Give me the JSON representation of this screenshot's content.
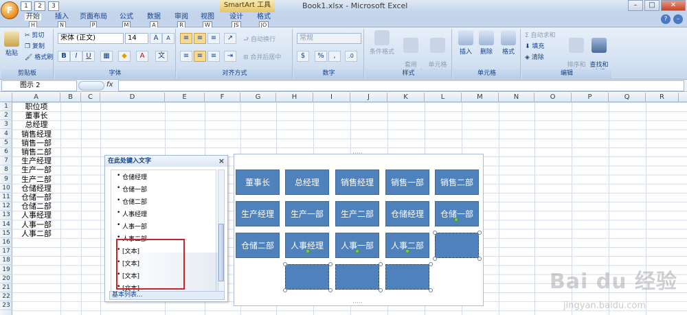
{
  "title": {
    "contextual_tab": "SmartArt 工具",
    "window_title": "Book1.xlsx - Microsoft Excel",
    "qat_keys": [
      "1",
      "2",
      "3"
    ],
    "controls": {
      "minimize": "–",
      "restore": "□",
      "close": "✕"
    }
  },
  "tabs": [
    {
      "label": "开始",
      "key": "H",
      "active": true
    },
    {
      "label": "插入",
      "key": "N"
    },
    {
      "label": "页面布局",
      "key": "P"
    },
    {
      "label": "公式",
      "key": "M"
    },
    {
      "label": "数据",
      "key": "A"
    },
    {
      "label": "审阅",
      "key": "R"
    },
    {
      "label": "视图",
      "key": "W"
    },
    {
      "label": "设计",
      "key": "JS"
    },
    {
      "label": "格式",
      "key": "JO"
    }
  ],
  "ribbon": {
    "clipboard": {
      "name": "剪贴板",
      "paste": "粘贴",
      "cut": "剪切",
      "copy": "复制",
      "format_painter": "格式刷"
    },
    "font": {
      "name": "字体",
      "font_name": "宋体 (正文)",
      "font_size": "14",
      "bold": "B",
      "italic": "I",
      "underline": "U"
    },
    "alignment": {
      "name": "对齐方式",
      "wrap": "自动换行",
      "merge": "合并后居中"
    },
    "number": {
      "name": "数字",
      "format": "常规",
      "percent": "%",
      "comma": ","
    },
    "styles": {
      "name": "样式",
      "conditional": "条件格式",
      "table": "套用\n表格格式",
      "cell": "单元格\n样式"
    },
    "cells": {
      "name": "单元格",
      "insert": "插入",
      "delete": "删除",
      "format": "格式"
    },
    "editing": {
      "name": "编辑",
      "autosum": "Σ 自动求和",
      "fill": "填充",
      "clear": "清除",
      "sort": "排序和\n筛选",
      "find": "查找和\n选择"
    }
  },
  "formula_bar": {
    "namebox": "图示 2",
    "fx": "fx",
    "value": ""
  },
  "columns": [
    "A",
    "B",
    "C",
    "D",
    "E",
    "F",
    "G",
    "H",
    "I",
    "J",
    "K",
    "L",
    "M",
    "N",
    "O",
    "P",
    "Q",
    "R"
  ],
  "rows": [
    "1",
    "2",
    "3",
    "4",
    "5",
    "6",
    "7",
    "8",
    "9",
    "10",
    "11",
    "12",
    "13",
    "14",
    "15",
    "16",
    "17",
    "18",
    "19",
    "20",
    "21",
    "22",
    "23"
  ],
  "column_a": [
    "职位项",
    "董事长",
    "总经理",
    "销售经理",
    "销售一部",
    "销售二部",
    "生产经理",
    "生产一部",
    "生产二部",
    "仓储经理",
    "仓储一部",
    "仓储二部",
    "人事经理",
    "人事一部",
    "人事二部"
  ],
  "text_pane": {
    "title": "在此处键入文字",
    "close": "×",
    "items": [
      "仓储经理",
      "仓储一部",
      "仓储二部",
      "人事经理",
      "人事一部",
      "人事二部",
      "[文本]",
      "[文本]",
      "[文本]",
      "[文本]"
    ],
    "footer": "基本列表..."
  },
  "smartart": {
    "nodes": [
      "董事长",
      "总经理",
      "销售经理",
      "销售一部",
      "销售二部",
      "生产经理",
      "生产一部",
      "生产二部",
      "仓储经理",
      "仓储一部",
      "仓储二部",
      "人事经理",
      "人事一部",
      "人事二部",
      "",
      "",
      "",
      ""
    ],
    "handle": "·····"
  },
  "watermark": {
    "brand": "Bai du 经验",
    "url": "jingyan.baidu.com"
  }
}
